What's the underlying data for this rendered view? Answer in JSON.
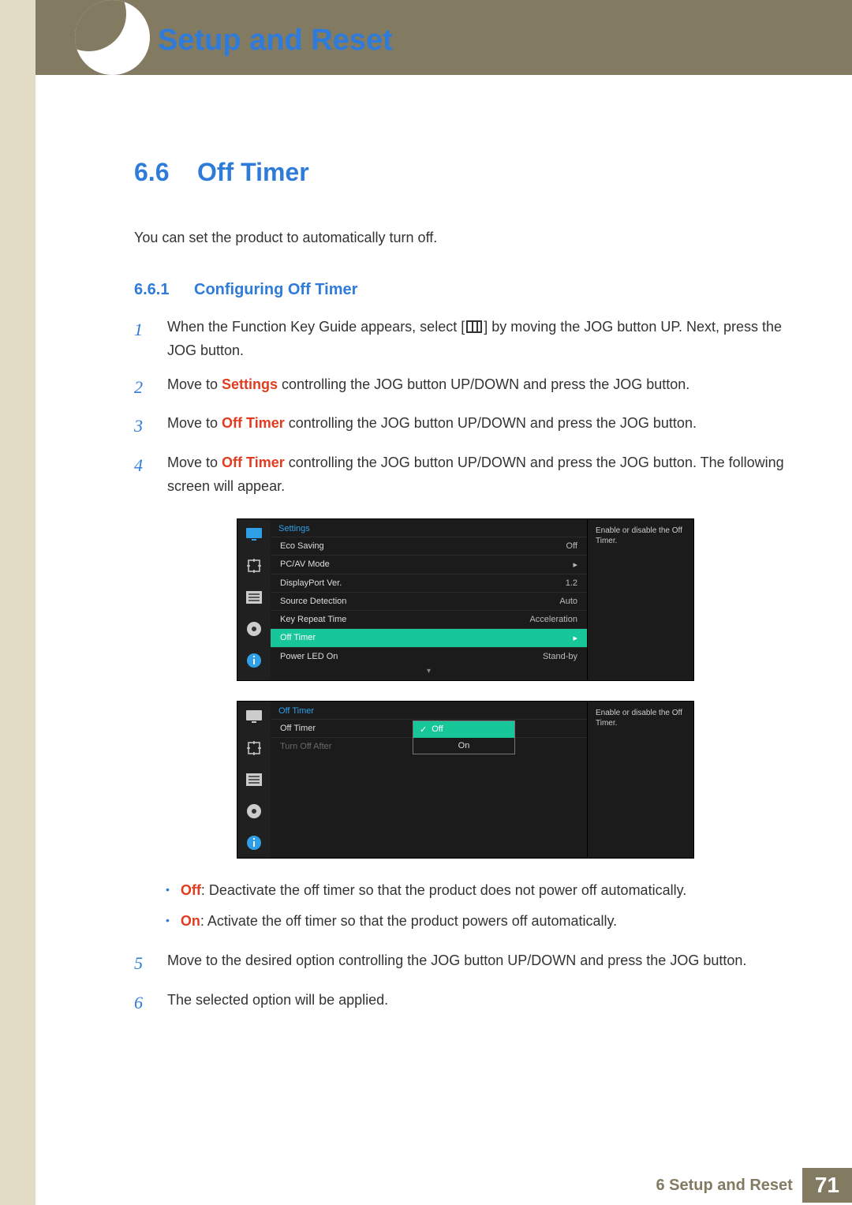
{
  "header": {
    "title": "Setup and Reset"
  },
  "section": {
    "number": "6.6",
    "title": "Off Timer"
  },
  "intro": "You can set the product to automatically turn off.",
  "subsection": {
    "number": "6.6.1",
    "title": "Configuring Off Timer"
  },
  "steps": {
    "s1a": "When the Function Key Guide appears, select [",
    "s1b": "] by moving the JOG button UP. Next, press the JOG button.",
    "s2a": "Move to ",
    "s2kw": "Settings",
    "s2b": " controlling the JOG button UP/DOWN and press the JOG button.",
    "s3a": "Move to ",
    "s3kw": "Off Timer",
    "s3b": " controlling the JOG button UP/DOWN and press the JOG button.",
    "s4a": "Move to ",
    "s4kw": "Off Timer",
    "s4b": " controlling the JOG button UP/DOWN and press the JOG button. The following screen will appear.",
    "s5": "Move to the desired option controlling the JOG button UP/DOWN and press the JOG button.",
    "s6": "The selected option will be applied."
  },
  "step_nums": {
    "n1": "1",
    "n2": "2",
    "n3": "3",
    "n4": "4",
    "n5": "5",
    "n6": "6"
  },
  "osd1": {
    "title": "Settings",
    "rows": [
      {
        "label": "Eco Saving",
        "value": "Off"
      },
      {
        "label": "PC/AV Mode",
        "value": "▸"
      },
      {
        "label": "DisplayPort Ver.",
        "value": "1.2"
      },
      {
        "label": "Source Detection",
        "value": "Auto"
      },
      {
        "label": "Key Repeat Time",
        "value": "Acceleration"
      },
      {
        "label": "Off Timer",
        "value": "▸",
        "hl": true
      },
      {
        "label": "Power LED On",
        "value": "Stand-by"
      }
    ],
    "help": "Enable or disable the Off Timer.",
    "scroll": "▾"
  },
  "osd2": {
    "title": "Off Timer",
    "rows": [
      {
        "label": "Off Timer",
        "value": ""
      },
      {
        "label": "Turn Off After",
        "value": "",
        "dim": true
      }
    ],
    "popup": {
      "off": "Off",
      "on": "On",
      "check": "✓"
    },
    "help": "Enable or disable the Off Timer."
  },
  "bullets": {
    "off_kw": "Off",
    "off_text": ": Deactivate the off timer so that the product does not power off automatically.",
    "on_kw": "On",
    "on_text": ": Activate the off timer so that the product powers off automatically."
  },
  "footer": {
    "label": "6 Setup and Reset",
    "page": "71"
  }
}
